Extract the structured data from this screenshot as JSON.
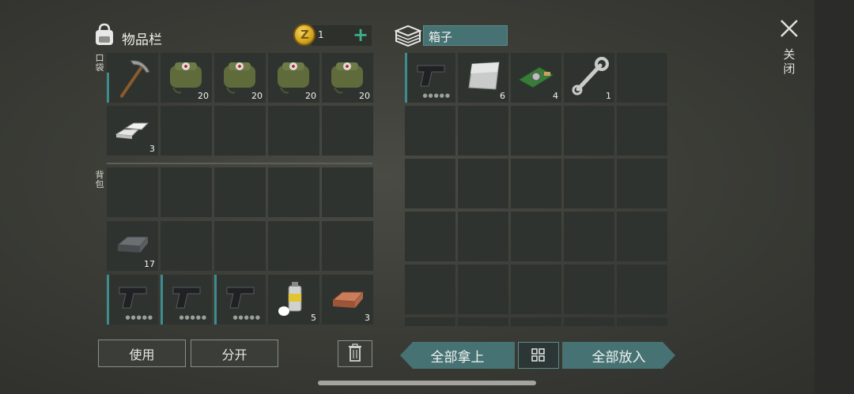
{
  "inventory": {
    "title": "物品栏",
    "coins": "1",
    "add_label": "+",
    "pockets_label": "口袋",
    "backpack_label": "背包",
    "pockets": [
      {
        "item": "pickaxe-icon",
        "qty": ""
      },
      {
        "item": "medkit-bag-icon",
        "qty": "20"
      },
      {
        "item": "medkit-bag-icon",
        "qty": "20"
      },
      {
        "item": "medkit-bag-icon",
        "qty": "20"
      },
      {
        "item": "medkit-bag-icon",
        "qty": "20"
      },
      {
        "item": "silver-ingots-icon",
        "qty": "3"
      },
      {
        "item": "",
        "qty": ""
      },
      {
        "item": "",
        "qty": ""
      },
      {
        "item": "",
        "qty": ""
      },
      {
        "item": "",
        "qty": ""
      }
    ],
    "backpack": [
      {
        "item": "",
        "qty": ""
      },
      {
        "item": "",
        "qty": ""
      },
      {
        "item": "",
        "qty": ""
      },
      {
        "item": "",
        "qty": ""
      },
      {
        "item": "",
        "qty": ""
      },
      {
        "item": "iron-bar-icon",
        "qty": "17"
      },
      {
        "item": "",
        "qty": ""
      },
      {
        "item": "",
        "qty": ""
      },
      {
        "item": "",
        "qty": ""
      },
      {
        "item": "",
        "qty": ""
      },
      {
        "item": "pistol-icon",
        "qty": ""
      },
      {
        "item": "pistol-icon",
        "qty": ""
      },
      {
        "item": "pistol-icon",
        "qty": ""
      },
      {
        "item": "spray-can-icon",
        "qty": "5"
      },
      {
        "item": "copper-bar-icon",
        "qty": "3"
      }
    ]
  },
  "box": {
    "name": "箱子",
    "slots_row1": [
      {
        "item": "pistol-icon",
        "qty": ""
      },
      {
        "item": "metal-plate-icon",
        "qty": "6"
      },
      {
        "item": "circuit-board-icon",
        "qty": "4"
      },
      {
        "item": "wrench-icon",
        "qty": "1"
      },
      {
        "item": "",
        "qty": ""
      }
    ]
  },
  "close_label": "关闭",
  "buttons": {
    "use": "使用",
    "split": "分开",
    "take_all": "全部拿上",
    "put_all": "全部放入"
  },
  "colors": {
    "accent": "#477273",
    "slot": "#2f3330",
    "teal_marker": "#3e8d8e"
  }
}
